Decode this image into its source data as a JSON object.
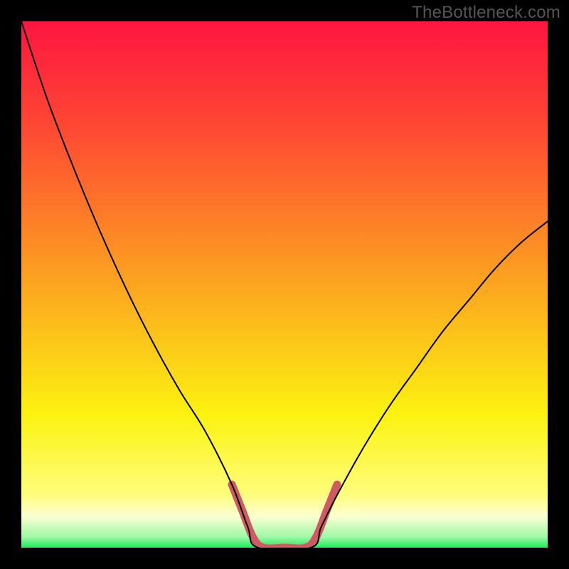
{
  "watermark": {
    "text": "TheBottleneck.com"
  },
  "chart_data": {
    "type": "line",
    "title": "",
    "xlabel": "",
    "ylabel": "",
    "xlim": [
      0,
      100
    ],
    "ylim": [
      0,
      100
    ],
    "grid": false,
    "series": [
      {
        "name": "curve-left",
        "x": [
          0,
          5,
          10,
          15,
          20,
          25,
          30,
          35,
          40,
          43,
          45
        ],
        "values": [
          100,
          85,
          72,
          60,
          49,
          39,
          30,
          22,
          12,
          4,
          0
        ],
        "stroke": "#000000",
        "width": 2
      },
      {
        "name": "flat-bottom",
        "x": [
          45,
          55
        ],
        "values": [
          0,
          0
        ],
        "stroke": "#000000",
        "width": 2
      },
      {
        "name": "curve-right",
        "x": [
          55,
          57,
          60,
          65,
          70,
          75,
          80,
          85,
          90,
          95,
          100
        ],
        "values": [
          0,
          4,
          10,
          19,
          27,
          34,
          41,
          47,
          53,
          58,
          62
        ],
        "stroke": "#000000",
        "width": 2
      },
      {
        "name": "optimal-highlight",
        "x": [
          40,
          42,
          44,
          46,
          50,
          54,
          56,
          58,
          60
        ],
        "values": [
          12,
          7,
          2,
          0,
          0,
          0,
          2,
          7,
          12
        ],
        "stroke": "#cf5b62",
        "width": 11
      }
    ],
    "gradient_bands": [
      {
        "y0": 100,
        "y1": 81,
        "c0": "#fe1540",
        "c1": "#fe4534"
      },
      {
        "y0": 81,
        "y1": 63,
        "c0": "#fe4534",
        "c1": "#fd7c28"
      },
      {
        "y0": 63,
        "y1": 44,
        "c0": "#fd7c28",
        "c1": "#fcb81c"
      },
      {
        "y0": 44,
        "y1": 25,
        "c0": "#fcb81c",
        "c1": "#fcf310"
      },
      {
        "y0": 25,
        "y1": 10,
        "c0": "#fcf310",
        "c1": "#fffd7e"
      },
      {
        "y0": 10,
        "y1": 6,
        "c0": "#fffd7e",
        "c1": "#fcffd2"
      },
      {
        "y0": 6,
        "y1": 2,
        "c0": "#fcffd2",
        "c1": "#9df8a6"
      },
      {
        "y0": 2,
        "y1": 0,
        "c0": "#9df8a6",
        "c1": "#1bea59"
      }
    ]
  }
}
